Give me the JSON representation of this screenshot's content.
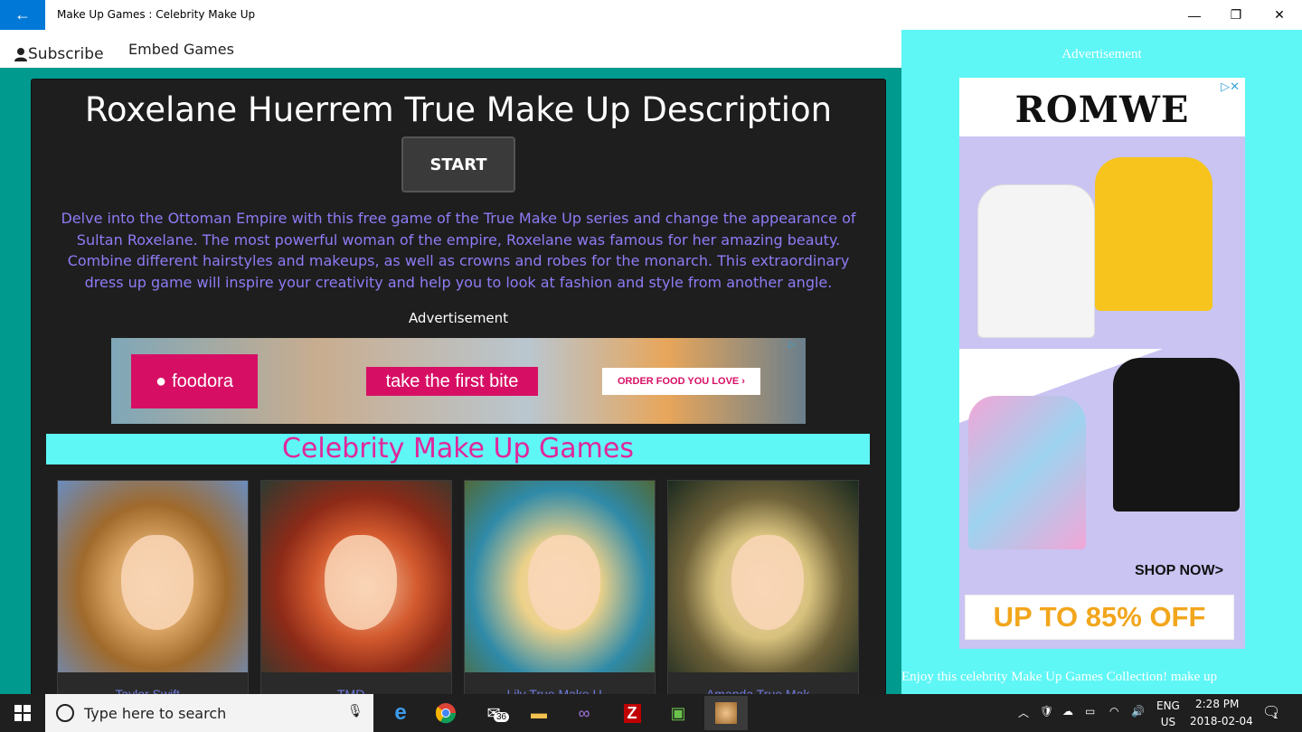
{
  "window": {
    "title": "Make Up Games : Celebrity Make Up",
    "back_icon": "←",
    "minimize_icon": "—",
    "maximize_icon": "❐",
    "close_icon": "✕"
  },
  "menu": {
    "subscribe": "Subscribe",
    "embed": "Embed Games"
  },
  "main": {
    "title": "Roxelane Huerrem True Make Up Description",
    "start_label": "START",
    "description": "Delve into the Ottoman Empire with this free game of the True Make Up series and change the appearance of Sultan Roxelane. The most powerful woman of the empire, Roxelane was famous for her amazing beauty. Combine different hairstyles and makeups, as well as crowns and robes for the monarch. This extraordinary dress up game will inspire your creativity and help you to look at fashion and style from another angle.",
    "ad_label": "Advertisement",
    "banner": {
      "brand": "foodora",
      "tagline": "take the first bite",
      "cta": "ORDER FOOD YOU LOVE ›"
    },
    "section_title": "Celebrity Make Up Games",
    "games": [
      {
        "label": "Taylor Swift..."
      },
      {
        "label": "TMD..."
      },
      {
        "label": "Lily True Make U..."
      },
      {
        "label": "Amanda True Mak..."
      }
    ]
  },
  "sidebar": {
    "ad_label": "Advertisement",
    "ad": {
      "brand": "ROMWE",
      "shop_now": "SHOP NOW>",
      "offer": "UP TO 85% OFF"
    },
    "footer_text": "Enjoy this celebrity Make Up Games Collection! make up"
  },
  "taskbar": {
    "search_placeholder": "Type here to search",
    "mail_badge": "36",
    "lang_top": "ENG",
    "lang_bottom": "US",
    "time": "2:28 PM",
    "date": "2018-02-04",
    "notif_count": "1"
  },
  "colors": {
    "accent": "#0078d7",
    "teal": "#009a8e",
    "cyan": "#5ff6f6",
    "section_text": "#e0279c",
    "description_text": "#8d7cf5",
    "foodora_pink": "#d70f64"
  }
}
